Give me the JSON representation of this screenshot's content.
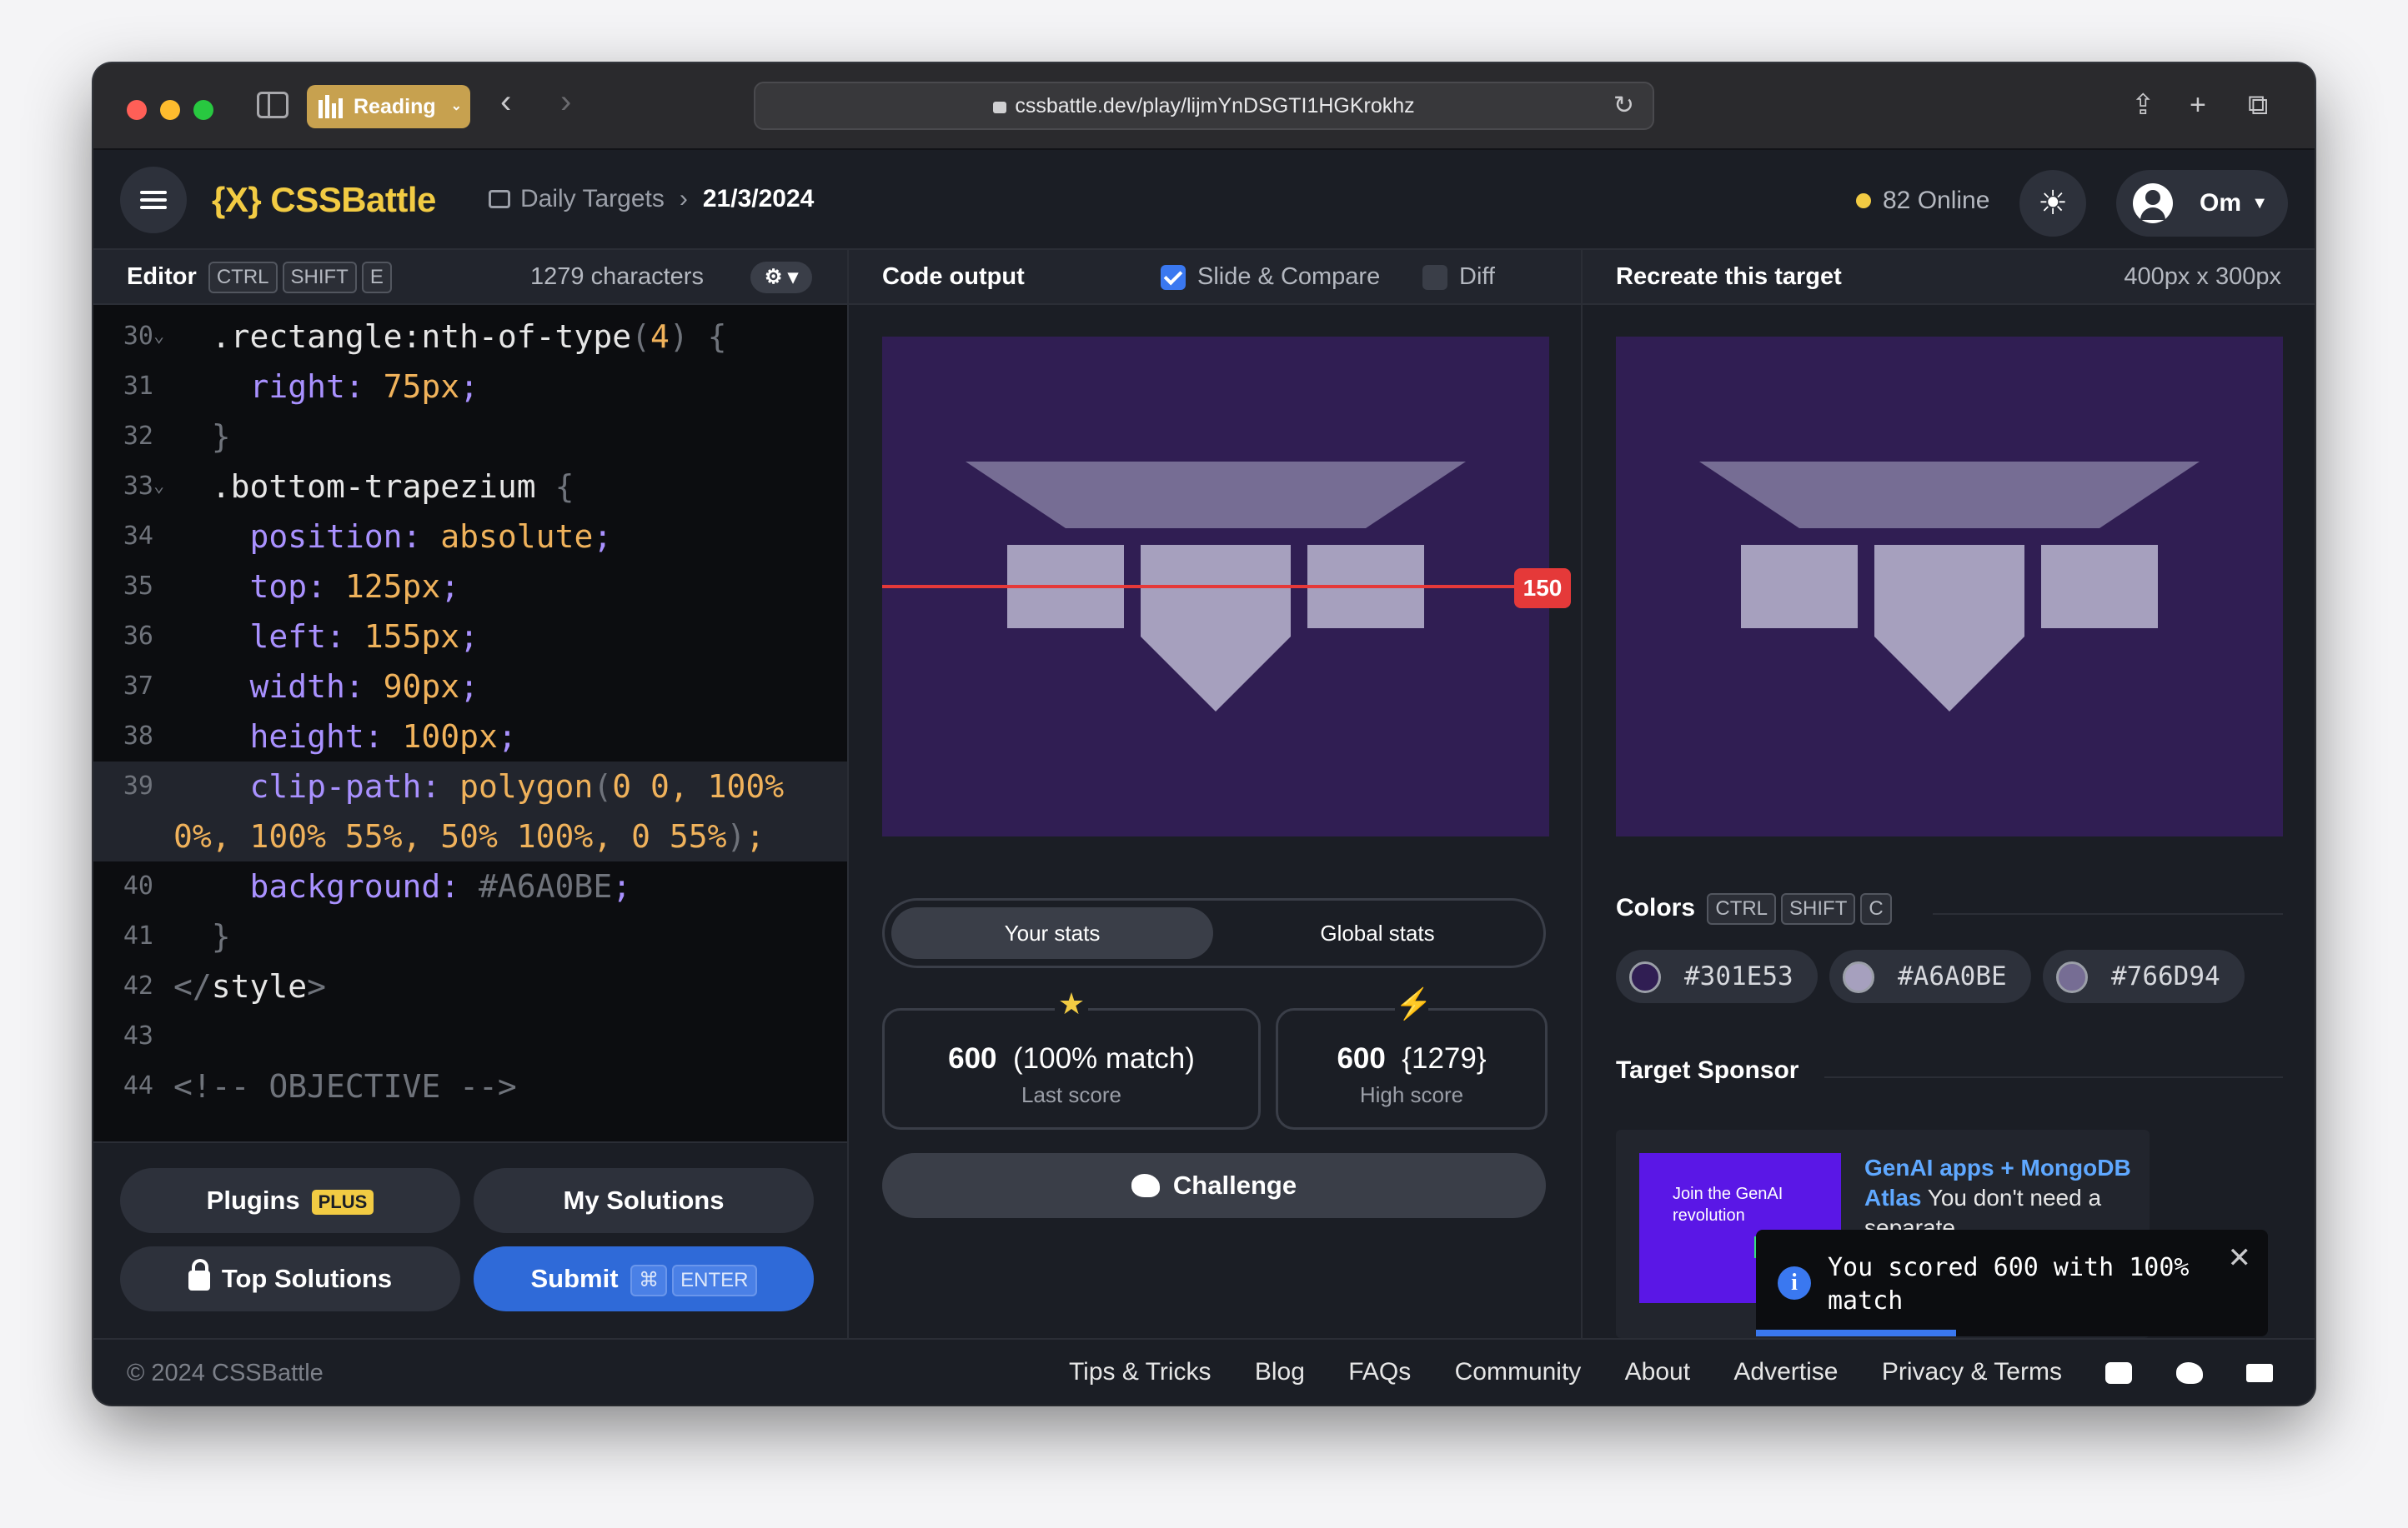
{
  "browser": {
    "reading_label": "Reading",
    "url": "cssbattle.dev/play/lijmYnDSGTI1HGKrokhz"
  },
  "header": {
    "logo": "{X} CSSBattle",
    "crumb_parent": "Daily Targets",
    "crumb_current": "21/3/2024",
    "online": "82 Online",
    "user": "Om"
  },
  "editor": {
    "title": "Editor",
    "kbd": [
      "CTRL",
      "SHIFT",
      "E"
    ],
    "chars": "1279 characters",
    "lines": [
      {
        "n": "30",
        "fold": true,
        "tokens": [
          [
            "w",
            "  .rectangle:nth-of-type"
          ],
          [
            "s",
            "("
          ],
          [
            "v",
            "4"
          ],
          [
            "s",
            ") {"
          ]
        ]
      },
      {
        "n": "31",
        "tokens": [
          [
            "p",
            "    right: "
          ],
          [
            "v",
            "75px"
          ],
          [
            "p",
            ";"
          ]
        ]
      },
      {
        "n": "32",
        "tokens": [
          [
            "s",
            "  }"
          ]
        ]
      },
      {
        "n": "33",
        "fold": true,
        "tokens": [
          [
            "w",
            "  .bottom-trapezium "
          ],
          [
            "s",
            "{"
          ]
        ]
      },
      {
        "n": "34",
        "tokens": [
          [
            "p",
            "    position: "
          ],
          [
            "v",
            "absolute"
          ],
          [
            "p",
            ";"
          ]
        ]
      },
      {
        "n": "35",
        "tokens": [
          [
            "p",
            "    top: "
          ],
          [
            "v",
            "125px"
          ],
          [
            "p",
            ";"
          ]
        ]
      },
      {
        "n": "36",
        "tokens": [
          [
            "p",
            "    left: "
          ],
          [
            "v",
            "155px"
          ],
          [
            "p",
            ";"
          ]
        ]
      },
      {
        "n": "37",
        "tokens": [
          [
            "p",
            "    width: "
          ],
          [
            "v",
            "90px"
          ],
          [
            "p",
            ";"
          ]
        ]
      },
      {
        "n": "38",
        "tokens": [
          [
            "p",
            "    height: "
          ],
          [
            "v",
            "100px"
          ],
          [
            "p",
            ";"
          ]
        ]
      },
      {
        "n": "39",
        "hl": true,
        "tokens": [
          [
            "p",
            "    clip-path: "
          ],
          [
            "v",
            "polygon"
          ],
          [
            "s",
            "("
          ],
          [
            "v",
            "0 0, 100%"
          ]
        ]
      },
      {
        "n": "",
        "hl": true,
        "tokens": [
          [
            "v",
            "0%, 100% 55%, 50% 100%, 0 55%"
          ],
          [
            "s",
            ")"
          ],
          [
            "v",
            ";"
          ]
        ]
      },
      {
        "n": "40",
        "tokens": [
          [
            "p",
            "    background: "
          ],
          [
            "s",
            "#A6A0BE"
          ],
          [
            "p",
            ";"
          ]
        ]
      },
      {
        "n": "41",
        "tokens": [
          [
            "s",
            "  }"
          ]
        ]
      },
      {
        "n": "42",
        "tokens": [
          [
            "s",
            "</"
          ],
          [
            "w",
            "style"
          ],
          [
            "s",
            ">"
          ]
        ]
      },
      {
        "n": "43",
        "tokens": [
          [
            "w",
            ""
          ]
        ]
      },
      {
        "n": "44",
        "tokens": [
          [
            "s",
            "<!-- OBJECTIVE -->"
          ]
        ]
      }
    ]
  },
  "buttons": {
    "plugins": "Plugins",
    "plus": "PLUS",
    "my_solutions": "My Solutions",
    "top_solutions": "Top Solutions",
    "submit": "Submit",
    "submit_kbd1": "⌘",
    "submit_kbd2": "ENTER"
  },
  "output": {
    "title": "Code output",
    "slide_compare": "Slide & Compare",
    "diff": "Diff",
    "slider_value": "150",
    "tab_your": "Your stats",
    "tab_global": "Global stats",
    "last_score_value": "600",
    "last_score_match": "(100% match)",
    "last_score_label": "Last score",
    "high_score_value": "600",
    "high_score_chars": "{1279}",
    "high_score_label": "High score",
    "challenge": "Challenge"
  },
  "target": {
    "title": "Recreate this target",
    "size": "400px x 300px",
    "colors_title": "Colors",
    "colors_kbd": [
      "CTRL",
      "SHIFT",
      "C"
    ],
    "colors": [
      "#301E53",
      "#A6A0BE",
      "#766D94"
    ],
    "sponsor_title": "Target Sponsor",
    "ad_image_text": "Join the GenAI revolution",
    "ad_headline": "GenAI apps + MongoDB Atlas",
    "ad_body": "You don't need a separate"
  },
  "toast": {
    "message": "You scored 600 with 100% match"
  },
  "footer": {
    "copyright": "© 2024 CSSBattle",
    "links": [
      "Tips & Tricks",
      "Blog",
      "FAQs",
      "Community",
      "About",
      "Advertise",
      "Privacy & Terms"
    ]
  }
}
